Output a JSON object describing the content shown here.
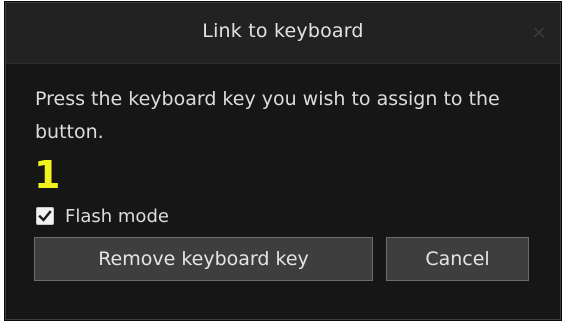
{
  "dialog": {
    "title": "Link to keyboard",
    "close_glyph": "×",
    "message": "Press the keyboard key you wish to assign to the button.",
    "assigned_key": "1",
    "flash_mode": {
      "label": "Flash mode",
      "checked": true
    },
    "buttons": {
      "remove_label": "Remove keyboard key",
      "cancel_label": "Cancel"
    },
    "colors": {
      "background": "#161616",
      "titlebar": "#222222",
      "key_highlight": "#f2f21c",
      "button": "#3e3e3e"
    }
  }
}
